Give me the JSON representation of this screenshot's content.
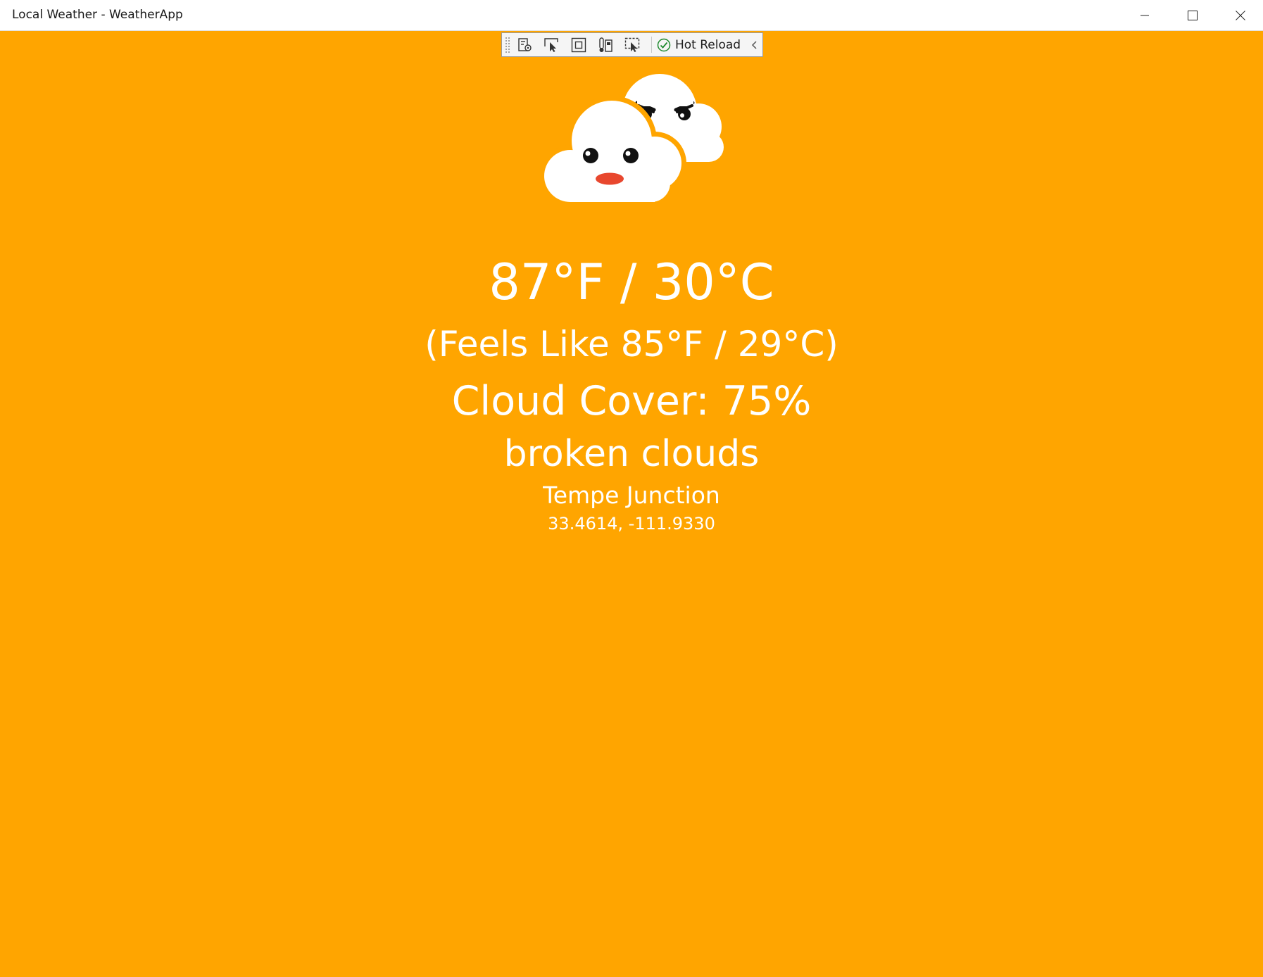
{
  "window": {
    "title": "Local Weather - WeatherApp",
    "controls": {
      "minimize_icon": "minimize-icon",
      "maximize_icon": "maximize-icon",
      "close_icon": "close-icon"
    }
  },
  "toolbar": {
    "tools": [
      {
        "icon": "live-visual-tree-icon"
      },
      {
        "icon": "select-element-icon"
      },
      {
        "icon": "display-layout-adorners-icon"
      },
      {
        "icon": "track-focus-icon"
      },
      {
        "icon": "preview-selection-icon"
      }
    ],
    "hot_reload_icon": "check-circle-icon",
    "hot_reload_label": "Hot Reload",
    "collapse_icon": "chevron-left-icon"
  },
  "weather": {
    "icon": "broken-clouds-icon",
    "temperature": "87°F / 30°C",
    "feels_like": "(Feels Like 85°F / 29°C)",
    "cloud_cover": "Cloud Cover: 75%",
    "description": "broken clouds",
    "location": "Tempe Junction",
    "coordinates": "33.4614, -111.9330"
  },
  "colors": {
    "background": "#FFA500",
    "text": "#FFFFFF",
    "cloud": "#FFFFFF",
    "mouth": "#E8472E",
    "hot_reload_check": "#1E8A2E"
  }
}
